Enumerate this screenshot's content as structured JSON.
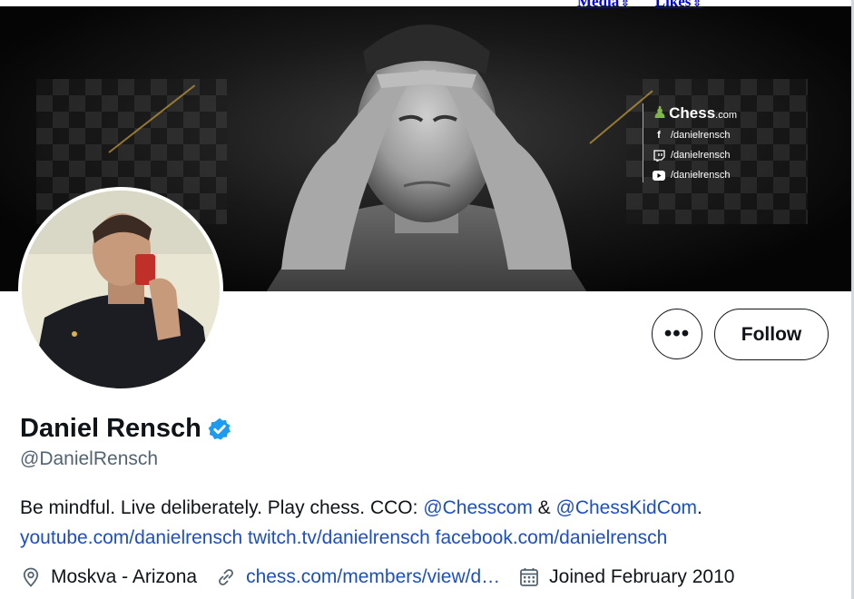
{
  "top_links": [
    {
      "label": "Media",
      "sort_glyph": "⇳"
    },
    {
      "label": "Likes",
      "sort_glyph": "⇳"
    }
  ],
  "banner": {
    "brand": "Chess",
    "brand_suffix": ".com",
    "socials": [
      {
        "icon": "facebook-icon",
        "glyph": "f",
        "handle": "/danielrensch"
      },
      {
        "icon": "twitch-icon",
        "glyph": "⌂",
        "handle": "/danielrensch"
      },
      {
        "icon": "youtube-icon",
        "glyph": "▶",
        "handle": "/danielrensch"
      }
    ]
  },
  "actions": {
    "more_label": "•••",
    "follow_label": "Follow"
  },
  "profile": {
    "name": "Daniel Rensch",
    "verified": true,
    "handle": "@DanielRensch",
    "bio": {
      "text1": "Be mindful. Live deliberately. Play chess. CCO: ",
      "mention1": "@Chesscom",
      "sep": " & ",
      "mention2": "@ChessKidCom",
      "text2": ".",
      "link_youtube": "youtube.com/danielrensch",
      "link_twitch": "twitch.tv/danielrensch",
      "link_facebook": "facebook.com/danielrensch"
    },
    "location": "Moskva - Arizona",
    "website": "chess.com/members/view/d…",
    "joined": "Joined February 2010"
  },
  "colors": {
    "link": "#1d4fc0",
    "verified": "#1d9bf0",
    "secondary_text": "#536471",
    "chess_green": "#81b64c"
  }
}
